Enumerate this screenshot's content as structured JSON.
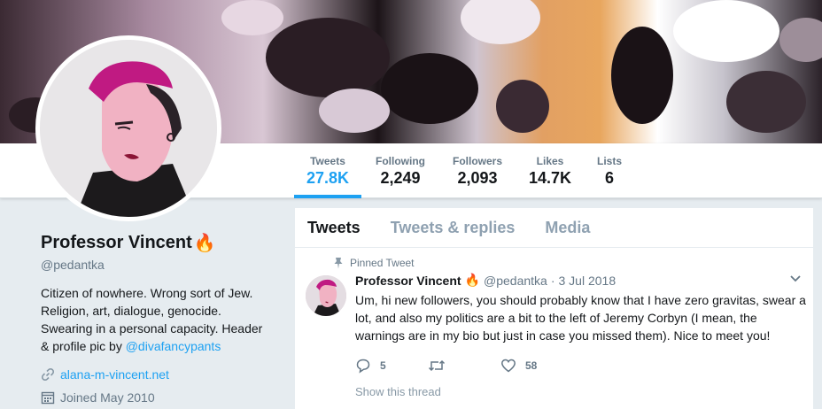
{
  "profile": {
    "name": "Professor Vincent",
    "name_emoji": "🔥",
    "handle": "@pedantka",
    "bio_text": "Citizen of nowhere. Wrong sort of Jew. Religion, art, dialogue, genocide. Swearing in a personal capacity. Header & profile pic by ",
    "bio_link": "@divafancypants",
    "website": "alana-m-vincent.net",
    "joined": "Joined May 2010"
  },
  "stats": [
    {
      "label": "Tweets",
      "value": "27.8K"
    },
    {
      "label": "Following",
      "value": "2,249"
    },
    {
      "label": "Followers",
      "value": "2,093"
    },
    {
      "label": "Likes",
      "value": "14.7K"
    },
    {
      "label": "Lists",
      "value": "6"
    }
  ],
  "tabs": [
    "Tweets",
    "Tweets & replies",
    "Media"
  ],
  "tweet": {
    "pinned_label": "Pinned Tweet",
    "name": "Professor Vincent",
    "name_emoji": "🔥",
    "handle": "@pedantka",
    "separator": "·",
    "date": "3 Jul 2018",
    "text": "Um, hi new followers, you should probably know that I have zero gravitas, swear a lot, and also my politics are a bit to the left of Jeremy Corbyn (I mean, the warnings are in my bio but just in case you missed them). Nice to meet you!",
    "replies": "5",
    "retweets": "",
    "likes": "58",
    "show_thread": "Show this thread"
  },
  "colors": {
    "accent": "#1da1f2",
    "muted": "#657786",
    "page_bg": "#e6ecf0"
  }
}
